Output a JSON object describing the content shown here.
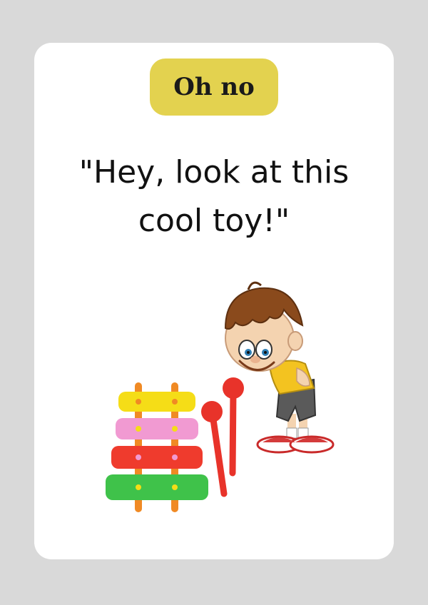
{
  "badge": {
    "label": "Oh no"
  },
  "quote": {
    "line1": "\"Hey, look at this",
    "line2": "cool toy!\""
  },
  "illustration": {
    "subjects": [
      "boy-character",
      "xylophone-toy"
    ],
    "colors": {
      "bar_yellow": "#f5dd17",
      "bar_pink": "#f19ad2",
      "bar_red": "#ef3b2d",
      "bar_green": "#3fc24a",
      "frame_orange": "#f08a24",
      "mallet_red": "#e8332a",
      "shirt_yellow": "#f3c320",
      "hair_brown": "#8a4a1c",
      "shorts_gray": "#5a5a5a"
    }
  }
}
